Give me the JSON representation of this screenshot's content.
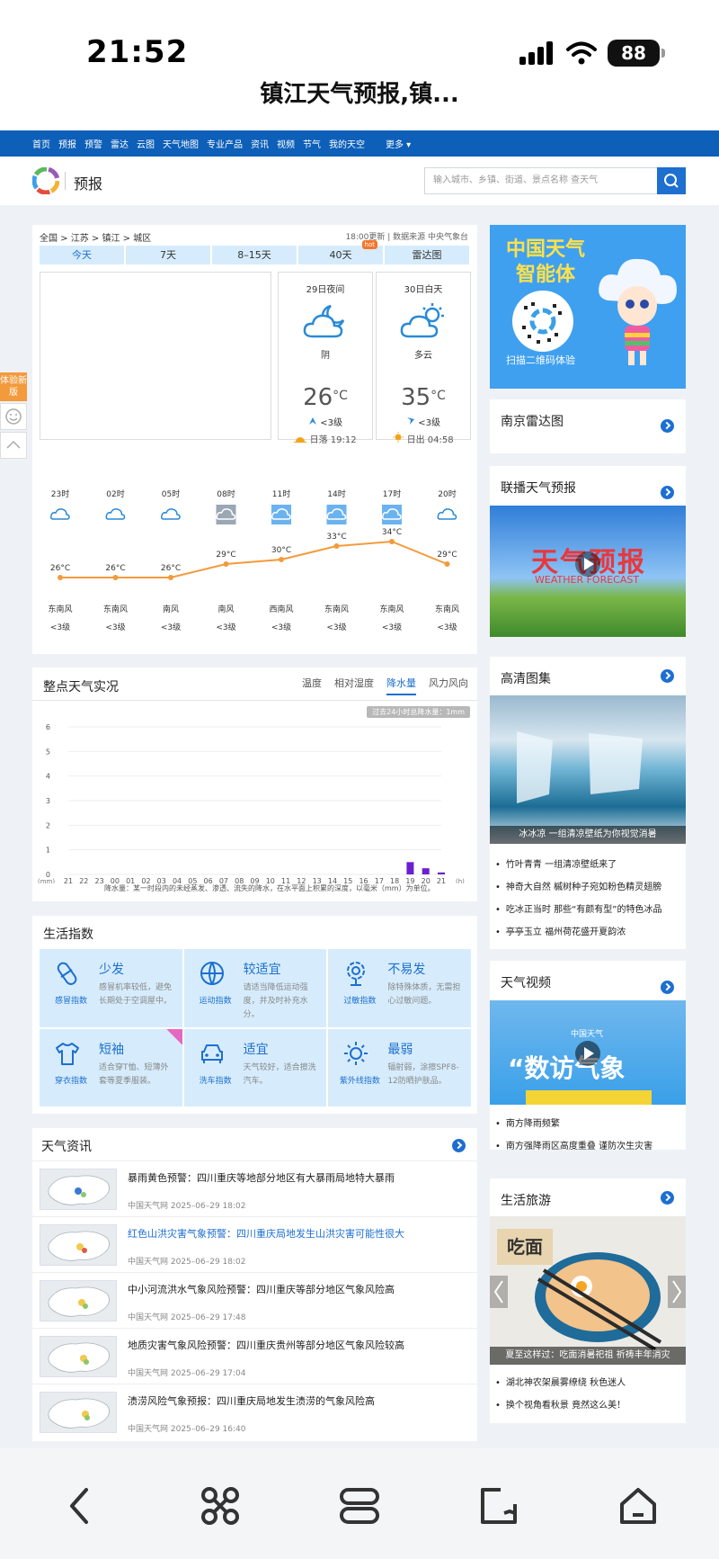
{
  "status": {
    "time": "21:52",
    "battery": "88",
    "page_title": "镇江天气预报,镇..."
  },
  "nav": {
    "items": [
      "首页",
      "预报",
      "预警",
      "雷达",
      "云图",
      "天气地图",
      "专业产品",
      "资讯",
      "视频",
      "节气",
      "我的天空"
    ],
    "more": "更多 ▾"
  },
  "header": {
    "title": "预报",
    "search_placeholder": "输入城市、乡镇、街道、景点名称 查天气"
  },
  "side": {
    "new_version": "体验新版"
  },
  "forecast": {
    "breadcrumb": "全国 > 江苏 > 镇江 > 城区",
    "update": "18:00更新 | 数据来源 中央气象台",
    "tabs": [
      "今天",
      "7天",
      "8–15天",
      "40天",
      "雷达图"
    ],
    "hot": "hot",
    "day1": {
      "date": "29日夜间",
      "weather": "阴",
      "temp": "26",
      "unit": "°C",
      "wind": "<3级",
      "sun": "日落 19:12"
    },
    "day2": {
      "date": "30日白天",
      "weather": "多云",
      "temp": "35",
      "unit": "°C",
      "wind": "<3级",
      "sun": "日出 04:58"
    },
    "hours": [
      {
        "t": "23时",
        "temp": "26°C",
        "dir": "东南风",
        "lv": "<3级"
      },
      {
        "t": "02时",
        "temp": "26°C",
        "dir": "东南风",
        "lv": "<3级"
      },
      {
        "t": "05时",
        "temp": "26°C",
        "dir": "南风",
        "lv": "<3级"
      },
      {
        "t": "08时",
        "temp": "29°C",
        "dir": "南风",
        "lv": "<3级"
      },
      {
        "t": "11时",
        "temp": "30°C",
        "dir": "西南风",
        "lv": "<3级"
      },
      {
        "t": "14时",
        "temp": "33°C",
        "dir": "东南风",
        "lv": "<3级"
      },
      {
        "t": "17时",
        "temp": "34°C",
        "dir": "东南风",
        "lv": "<3级"
      },
      {
        "t": "20时",
        "temp": "29°C",
        "dir": "东南风",
        "lv": "<3级"
      }
    ]
  },
  "realtime": {
    "title": "整点天气实况",
    "tabs": [
      "温度",
      "相对湿度",
      "降水量",
      "风力风向"
    ],
    "badge": "过去24小时总降水量：1mm",
    "note": "降水量：某一时段内的未经蒸发、渗透、流失的降水，在水平面上积累的深度，以毫米（mm）为单位。"
  },
  "chart_data": {
    "type": "bar",
    "ylabel": "(mm)",
    "xlabel": "(h)",
    "categories": [
      "21",
      "22",
      "23",
      "00",
      "01",
      "02",
      "03",
      "04",
      "05",
      "06",
      "07",
      "08",
      "09",
      "10",
      "11",
      "12",
      "13",
      "14",
      "15",
      "16",
      "17",
      "18",
      "19",
      "20",
      "21"
    ],
    "values": [
      0,
      0,
      0,
      0,
      0,
      0,
      0,
      0,
      0,
      0,
      0,
      0,
      0,
      0,
      0,
      0,
      0,
      0,
      0,
      0,
      0,
      0,
      0.5,
      0.25,
      0.08
    ],
    "ylim": [
      0,
      6
    ],
    "yticks": [
      "0",
      "1",
      "2",
      "3",
      "4",
      "5",
      "6"
    ],
    "color": "#6a1fd1"
  },
  "life": {
    "title": "生活指数",
    "items": [
      {
        "name": "感冒指数",
        "level": "少发",
        "desc": "感冒机率较低，避免长期处于空调屋中。"
      },
      {
        "name": "运动指数",
        "level": "较适宜",
        "desc": "请适当降低运动强度，并及时补充水分。"
      },
      {
        "name": "过敏指数",
        "level": "不易发",
        "desc": "除特殊体质，无需担心过敏问题。"
      },
      {
        "name": "穿衣指数",
        "level": "短袖",
        "desc": "适合穿T恤、短薄外套等夏季服装。"
      },
      {
        "name": "洗车指数",
        "level": "适宜",
        "desc": "天气较好，适合擦洗汽车。"
      },
      {
        "name": "紫外线指数",
        "level": "最弱",
        "desc": "辐射弱，涂擦SPF8-12防晒护肤品。"
      }
    ]
  },
  "news": {
    "title": "天气资讯",
    "items": [
      {
        "head": "暴雨黄色预警：四川重庆等地部分地区有大暴雨局地特大暴雨",
        "meta": "中国天气网  2025–06–29 18:02"
      },
      {
        "head": "红色山洪灾害气象预警：四川重庆局地发生山洪灾害可能性很大",
        "meta": "中国天气网  2025–06–29 18:02"
      },
      {
        "head": "中小河流洪水气象风险预警：四川重庆等部分地区气象风险高",
        "meta": "中国天气网  2025–06–29 17:48"
      },
      {
        "head": "地质灾害气象风险预警：四川重庆贵州等部分地区气象风险较高",
        "meta": "中国天气网  2025–06–29 17:04"
      },
      {
        "head": "渍涝风险气象预报：四川重庆局地发生渍涝的气象风险高",
        "meta": "中国天气网  2025–06–29 16:40"
      }
    ]
  },
  "right": {
    "ad": {
      "title": "中国天气智能体",
      "scan": "扫描二维码体验"
    },
    "radar": "南京雷达图",
    "lianbo": {
      "title": "联播天气预报",
      "banner": "天气预报",
      "banner_en": "WEATHER FORECAST"
    },
    "gallery": {
      "title": "高清图集",
      "caption": "冰冰凉 一组清凉壁纸为你视觉消暑",
      "items": [
        "竹叶青青 一组清凉壁纸来了",
        "神奇大自然 槭树种子宛如粉色精灵翅膀",
        "吃冰正当时 那些“有颜有型”的特色冰品",
        "亭亭玉立 福州荷花盛开夏韵浓"
      ]
    },
    "video": {
      "title": "天气视频",
      "logo": "中国天气",
      "banner": "“数访气象",
      "items": [
        "南方降雨频繁",
        "南方强降雨区高度重叠 谨防次生灾害"
      ]
    },
    "travel": {
      "title": "生活旅游",
      "tag": "吃面",
      "caption": "夏至这样过：吃面消暑祀祖 祈祷丰年消灾",
      "items": [
        "湖北神农架晨雾缭绕 秋色迷人",
        "换个视角看秋景 竟然这么美！"
      ]
    }
  }
}
